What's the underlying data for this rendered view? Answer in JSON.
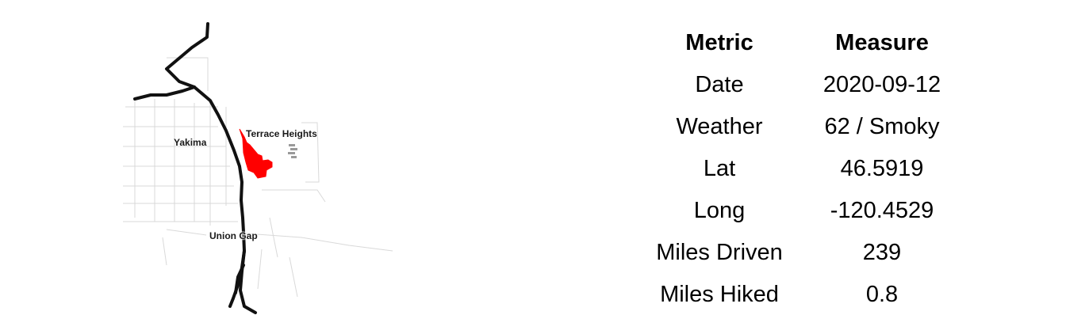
{
  "map": {
    "places": {
      "yakima": "Yakima",
      "terrace_heights": "Terrace Heights",
      "union_gap": "Union Gap"
    },
    "highlight_color": "#ff0000",
    "road_color": "#111111",
    "street_color": "#d9d9d9"
  },
  "table": {
    "headers": {
      "metric": "Metric",
      "measure": "Measure"
    },
    "rows": [
      {
        "metric": "Date",
        "measure": "2020-09-12"
      },
      {
        "metric": "Weather",
        "measure": "62 / Smoky"
      },
      {
        "metric": "Lat",
        "measure": "46.5919"
      },
      {
        "metric": "Long",
        "measure": "-120.4529"
      },
      {
        "metric": "Miles Driven",
        "measure": "239"
      },
      {
        "metric": "Miles Hiked",
        "measure": "0.8"
      }
    ]
  }
}
